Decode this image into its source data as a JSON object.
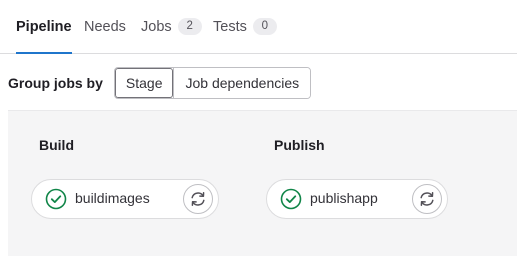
{
  "tabs": [
    {
      "label": "Pipeline",
      "active": true
    },
    {
      "label": "Needs",
      "active": false
    },
    {
      "label": "Jobs",
      "count": "2",
      "active": false
    },
    {
      "label": "Tests",
      "count": "0",
      "active": false
    }
  ],
  "group_by": {
    "label": "Group jobs by",
    "options": [
      "Stage",
      "Job dependencies"
    ],
    "selected": "Stage"
  },
  "stages": [
    {
      "title": "Build",
      "jobs": [
        {
          "name": "buildimages",
          "status": "success",
          "status_icon": "check-circle-icon",
          "action_icon": "retry-icon"
        }
      ]
    },
    {
      "title": "Publish",
      "jobs": [
        {
          "name": "publishapp",
          "status": "success",
          "status_icon": "check-circle-icon",
          "action_icon": "retry-icon"
        }
      ]
    }
  ],
  "colors": {
    "accent": "#1f75cb",
    "success": "#108548",
    "graph_bg": "#f5f5f6"
  }
}
